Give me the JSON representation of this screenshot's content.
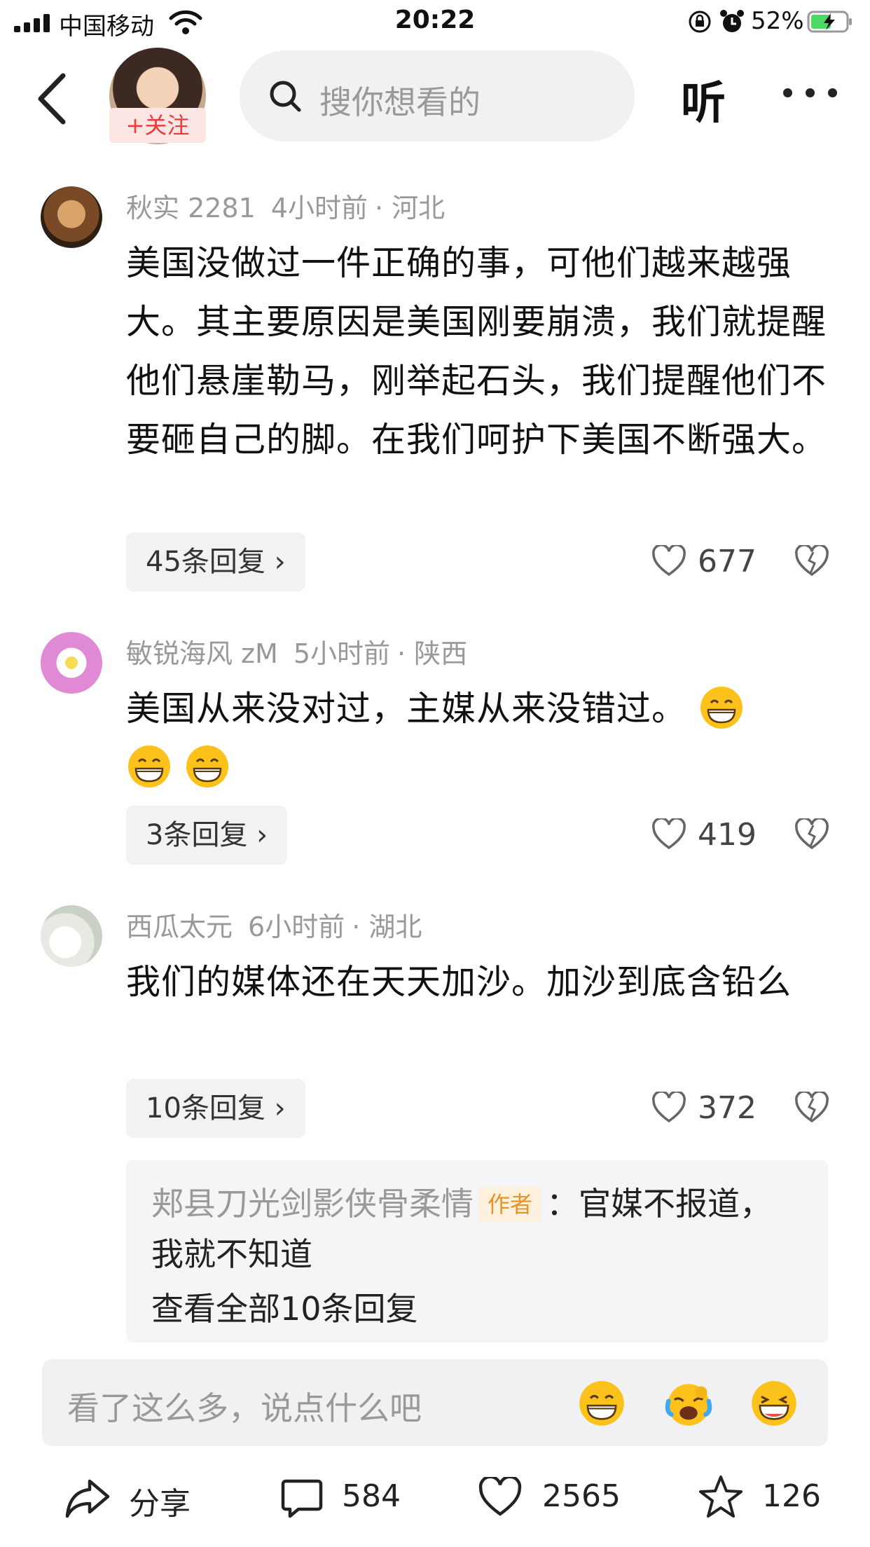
{
  "status_bar": {
    "carrier": "中国移动",
    "time": "20:22",
    "battery_percent": "52%",
    "icons": [
      "signal-icon",
      "wifi-icon",
      "rotation-lock-icon",
      "alarm-icon",
      "battery-charging-icon"
    ]
  },
  "header": {
    "back_icon": "chevron-left-icon",
    "follow_label": "+关注",
    "search_placeholder": "搜你想看的",
    "listen_label": "听",
    "more_icon": "more-dots-icon"
  },
  "comments": [
    {
      "user": "秋实 2281",
      "time": "4小时前",
      "location": "· 河北",
      "text": "美国没做过一件正确的事，可他们越来越强大。其主要原因是美国刚要崩溃，我们就提醒他们悬崖勒马，刚举起石头，我们提醒他们不要砸自己的脚。在我们呵护下美国不断强大。",
      "replies_label": "45条回复",
      "likes": "677"
    },
    {
      "user": "敏锐海风 zM",
      "time": "5小时前",
      "location": "· 陕西",
      "text": "美国从来没对过，主媒从来没错过。",
      "replies_label": "3条回复",
      "likes": "419"
    },
    {
      "user": "西瓜太元",
      "time": "6小时前",
      "location": "· 湖北",
      "text": "我们的媒体还在天天加沙。加沙到底含铅么",
      "replies_label": "10条回复",
      "likes": "372"
    }
  ],
  "sub_reply": {
    "author": "郏县刀光剑影侠骨柔情",
    "author_tag": "作者",
    "text": "：官媒不报道，我就不知道",
    "view_all": "查看全部10条回复"
  },
  "input_bar": {
    "placeholder": "看了这么多，说点什么吧"
  },
  "actions": {
    "share_label": "分享",
    "comments_count": "584",
    "likes_count": "2565",
    "favorites_count": "126"
  },
  "colors": {
    "accent_red": "#f03a3a",
    "author_tag": "#e3952c",
    "meta_gray": "#999999",
    "pill_bg": "#f2f2f4"
  }
}
